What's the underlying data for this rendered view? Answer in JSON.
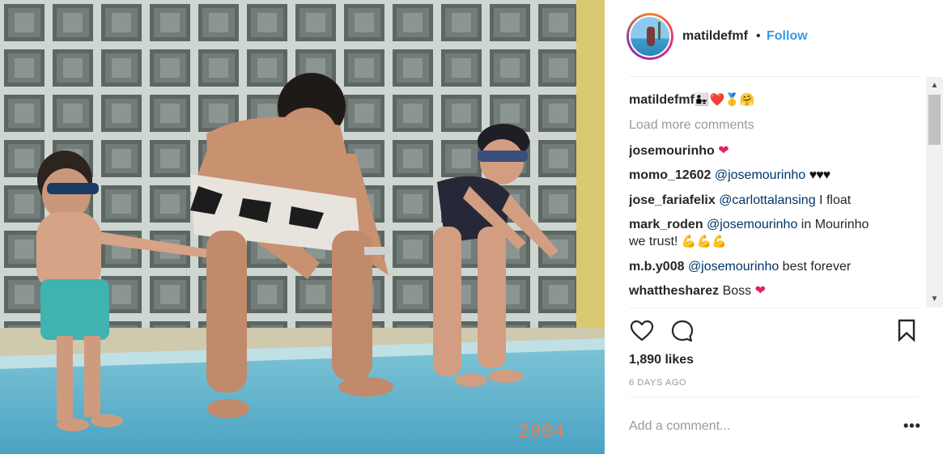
{
  "post": {
    "username": "matildefmf",
    "separator": "•",
    "follow_label": "Follow",
    "photo_stamp": "2004"
  },
  "caption": {
    "username": "matildefmf",
    "emoji": "👨‍👧❤️🥇🤗"
  },
  "load_more_label": "Load more comments",
  "comments": [
    {
      "username": "josemourinho",
      "mention": "",
      "text": "",
      "emoji": "❤"
    },
    {
      "username": "momo_12602",
      "mention": "@josemourinho",
      "text": "",
      "emoji": "♥♥♥"
    },
    {
      "username": "jose_fariafelix",
      "mention": "@carlottalansing",
      "text": " I float",
      "emoji": ""
    },
    {
      "username": "mark_roden",
      "mention": "@josemourinho",
      "text": " in Mourinho",
      "line2": "we trust! ",
      "emoji": "💪💪💪"
    },
    {
      "username": "m.b.y008",
      "mention": "@josemourinho",
      "text": " best forever",
      "emoji": ""
    },
    {
      "username": "whatthesharez",
      "mention": "",
      "text": " Boss ",
      "emoji": "❤"
    }
  ],
  "likes_label": "1,890 likes",
  "time_label": "6 DAYS AGO",
  "comment_box": {
    "placeholder": "Add a comment..."
  },
  "more_label": "•••",
  "icons": {
    "like": "heart-outline-icon",
    "comment": "speech-bubble-icon",
    "save": "bookmark-icon",
    "more": "more-options-icon"
  },
  "colors": {
    "link_blue": "#3897f0",
    "mention_blue": "#003569",
    "heart_red": "#e0245e",
    "muted_gray": "#999999"
  }
}
